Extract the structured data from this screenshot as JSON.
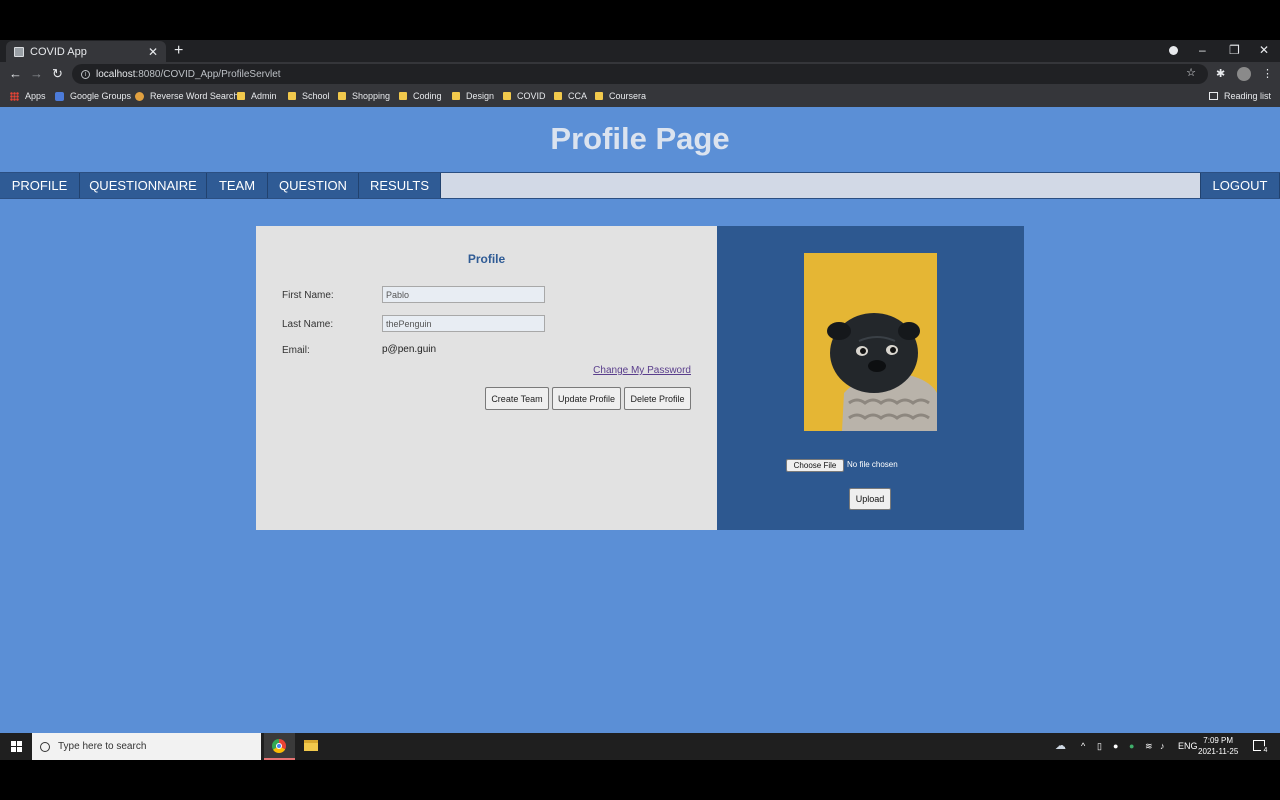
{
  "browser": {
    "tab_title": "COVID App",
    "tab_close": "✕",
    "new_tab": "+",
    "window_controls": {
      "minimize": "–",
      "maximize": "❐",
      "close": "✕"
    },
    "nav": {
      "back": "←",
      "forward": "→",
      "reload": "↻"
    },
    "url_host": "localhost",
    "url_path": ":8080/COVID_App/ProfileServlet",
    "bookmarks": [
      "Apps",
      "Google Groups",
      "Reverse Word Search",
      "Admin",
      "School",
      "Shopping",
      "Coding",
      "Design",
      "COVID",
      "CCA",
      "Coursera"
    ],
    "reading_list": "Reading list"
  },
  "page": {
    "title": "Profile Page",
    "nav": [
      "PROFILE",
      "QUESTIONNAIRE",
      "TEAM",
      "QUESTION",
      "RESULTS"
    ],
    "logout": "LOGOUT"
  },
  "profile": {
    "heading": "Profile",
    "first_name_label": "First Name:",
    "first_name_value": "Pablo",
    "last_name_label": "Last Name:",
    "last_name_value": "thePenguin",
    "email_label": "Email:",
    "email_value": "p@pen.guin",
    "change_password": "Change My Password",
    "buttons": {
      "create_team": "Create Team",
      "update_profile": "Update Profile",
      "delete_profile": "Delete Profile"
    }
  },
  "photo_panel": {
    "choose_file": "Choose File",
    "no_file": "No file chosen",
    "upload": "Upload"
  },
  "taskbar": {
    "search_placeholder": "Type here to search",
    "lang": "ENG",
    "time": "7:09 PM",
    "date": "2021-11-25",
    "notification_count": "4"
  },
  "colors": {
    "page_bg": "#5b8fd6",
    "nav_bg": "#2f5b95",
    "panel_bg": "#2d5890",
    "card_bg": "#e2e2e2"
  }
}
